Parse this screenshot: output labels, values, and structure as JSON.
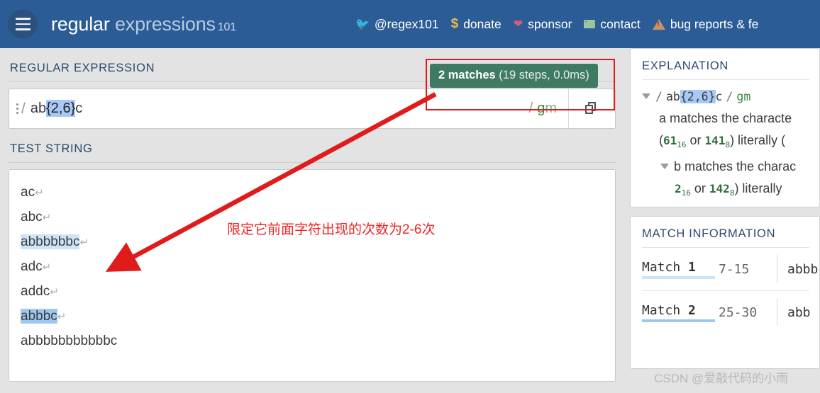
{
  "header": {
    "menu_icon": "hamburger-icon",
    "brand_bold": "regular",
    "brand_light": "expressions",
    "brand_num": "101",
    "nav": [
      {
        "icon": "twitter-icon",
        "label": "@regex101"
      },
      {
        "icon": "dollar-icon",
        "label": "donate"
      },
      {
        "icon": "heart-icon",
        "label": "sponsor"
      },
      {
        "icon": "mail-icon",
        "label": "contact"
      },
      {
        "icon": "warning-icon",
        "label": "bug reports & fe"
      }
    ]
  },
  "regex_section": {
    "label": "REGULAR EXPRESSION",
    "menu_icon": "vertical-dots-icon",
    "delimiter": "/",
    "pattern_before": "ab",
    "pattern_highlight": "{2,6}",
    "pattern_after": "c",
    "flag_slash": "/",
    "flag_g": "g",
    "flag_m": "m",
    "copy_icon": "copy-icon"
  },
  "match_badge": {
    "count_text": "2 matches",
    "detail_text": " (19 steps, 0.0ms)",
    "bg_color": "#3f7a63"
  },
  "test_section": {
    "label": "TEST STRING",
    "pilcrow": "↵",
    "lines": [
      {
        "text": "ac",
        "highlight": "none",
        "newline": true
      },
      {
        "text": "abc",
        "highlight": "none",
        "newline": true
      },
      {
        "text": "abbbbbbc",
        "highlight": "light",
        "newline": true
      },
      {
        "text": "adc",
        "highlight": "none",
        "newline": true
      },
      {
        "text": "addc",
        "highlight": "none",
        "newline": true
      },
      {
        "text": "abbbc",
        "highlight": "dark",
        "newline": true
      },
      {
        "text": "abbbbbbbbbbbc",
        "highlight": "none",
        "newline": false
      }
    ]
  },
  "annotation": {
    "text": "限定它前面字符出现的次数为2-6次",
    "color": "#ef2222",
    "arrow": "red-arrow",
    "rect": "red-rectangle"
  },
  "explanation": {
    "title": "EXPLANATION",
    "caret_icon": "caret-down-icon",
    "pattern_slash_open": "/",
    "pattern_before": "ab",
    "pattern_highlight": "{2,6}",
    "pattern_after": "c",
    "pattern_slash_close": "/",
    "flags": "gm",
    "line_a": "a matches the characte",
    "line_a_codes_pre": "(",
    "line_a_hex": "61",
    "line_a_hex_sub": "16",
    "line_a_or": " or ",
    "line_a_oct": "141",
    "line_a_oct_sub": "8",
    "line_a_tail": ") literally (",
    "line_b": "b matches the charac",
    "line_b_hex": "2",
    "line_b_hex_sub": "16",
    "line_b_or": " or ",
    "line_b_oct": "142",
    "line_b_oct_sub": "8",
    "line_b_tail": ") literally"
  },
  "match_information": {
    "title": "MATCH INFORMATION",
    "rows": [
      {
        "label": "Match",
        "index": "1",
        "range": "7-15",
        "value": "abbb",
        "underline": "light"
      },
      {
        "label": "Match",
        "index": "2",
        "range": "25-30",
        "value": "abb",
        "underline": "dark"
      }
    ]
  },
  "watermark": {
    "text": "CSDN @爱敲代码的小雨"
  },
  "colors": {
    "header_blue": "#2b5c96",
    "page_bg": "#e3e3e3",
    "highlight_blue": "#a8c8f5",
    "match_light": "#cfe3f8",
    "match_dark": "#9dc8f2",
    "annotation_red": "#ef2222",
    "badge_green": "#3f7a63"
  }
}
